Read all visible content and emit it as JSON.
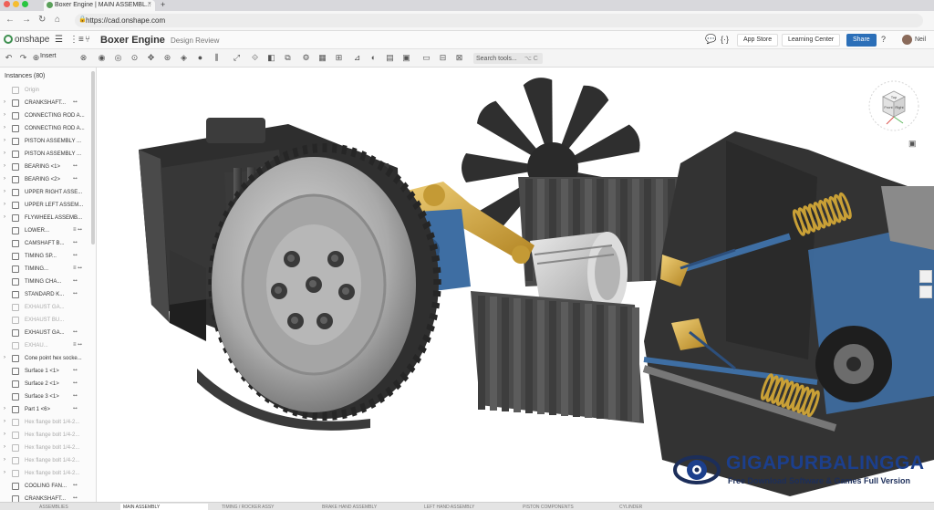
{
  "browser": {
    "tab_title": "Boxer Engine | MAIN ASSEMBL...",
    "new_tab": "+",
    "url": "https://cad.onshape.com"
  },
  "app": {
    "brand": "onshape",
    "doc_title": "Boxer Engine",
    "doc_subtitle": "Design Review",
    "buttons": {
      "app_store": "App Store",
      "learning_center": "Learning Center",
      "share": "Share",
      "help": "?",
      "user": "Neil"
    }
  },
  "toolbar": {
    "insert": "Insert",
    "search_placeholder": "Search tools...",
    "search_shortcut": "⌥ C"
  },
  "instances": {
    "header": "Instances (80)",
    "items": [
      {
        "label": "Origin",
        "chev": "",
        "extra": "",
        "dim": true
      },
      {
        "label": "CRANKSHAFT...",
        "chev": "›",
        "extra": "⭤",
        "dim": false
      },
      {
        "label": "CONNECTING ROD A...",
        "chev": "›",
        "extra": "",
        "dim": false
      },
      {
        "label": "CONNECTING ROD A...",
        "chev": "›",
        "extra": "",
        "dim": false
      },
      {
        "label": "PISTON ASSEMBLY ...",
        "chev": "›",
        "extra": "",
        "dim": false
      },
      {
        "label": "PISTON ASSEMBLY ...",
        "chev": "›",
        "extra": "",
        "dim": false
      },
      {
        "label": "BEARING <1>",
        "chev": "›",
        "extra": "⭤",
        "dim": false
      },
      {
        "label": "BEARING <2>",
        "chev": "›",
        "extra": "⭤",
        "dim": false
      },
      {
        "label": "UPPER RIGHT ASSE...",
        "chev": "›",
        "extra": "",
        "dim": false
      },
      {
        "label": "UPPER LEFT ASSEM...",
        "chev": "›",
        "extra": "",
        "dim": false
      },
      {
        "label": "FLYWHEEL ASSEMB...",
        "chev": "›",
        "extra": "",
        "dim": false
      },
      {
        "label": "LOWER...",
        "chev": "",
        "extra": "≡ ⭤",
        "dim": false
      },
      {
        "label": "CAMSHAFT B...",
        "chev": "",
        "extra": "⭤",
        "dim": false
      },
      {
        "label": "TIMING SP...",
        "chev": "",
        "extra": "⭤",
        "dim": false
      },
      {
        "label": "TIMING...",
        "chev": "",
        "extra": "≡ ⭤",
        "dim": false
      },
      {
        "label": "TIMING CHA...",
        "chev": "",
        "extra": "⭤",
        "dim": false
      },
      {
        "label": "STANDARD K...",
        "chev": "",
        "extra": "⭤",
        "dim": false
      },
      {
        "label": "EXHAUST GA...",
        "chev": "",
        "extra": "",
        "dim": true
      },
      {
        "label": "EXHAUST BU...",
        "chev": "",
        "extra": "",
        "dim": true
      },
      {
        "label": "EXHAUST GA...",
        "chev": "",
        "extra": "⭤",
        "dim": false
      },
      {
        "label": "EXHAU...",
        "chev": "",
        "extra": "≡ ⭤",
        "dim": true
      },
      {
        "label": "Cone point hex socke...",
        "chev": "›",
        "extra": "",
        "dim": false
      },
      {
        "label": "Surface 1 <1>",
        "chev": "",
        "extra": "⭤",
        "dim": false
      },
      {
        "label": "Surface 2 <1>",
        "chev": "",
        "extra": "⭤",
        "dim": false
      },
      {
        "label": "Surface 3 <1>",
        "chev": "",
        "extra": "⭤",
        "dim": false
      },
      {
        "label": "Part 1 <6>",
        "chev": "›",
        "extra": "⭤",
        "dim": false
      },
      {
        "label": "Hex flange bolt 1/4-2...",
        "chev": "›",
        "extra": "",
        "dim": true
      },
      {
        "label": "Hex flange bolt 1/4-2...",
        "chev": "›",
        "extra": "",
        "dim": true
      },
      {
        "label": "Hex flange bolt 1/4-2...",
        "chev": "›",
        "extra": "",
        "dim": true
      },
      {
        "label": "Hex flange bolt 1/4-2...",
        "chev": "›",
        "extra": "",
        "dim": true
      },
      {
        "label": "Hex flange bolt 1/4-2...",
        "chev": "›",
        "extra": "",
        "dim": true
      },
      {
        "label": "COOLING FAN...",
        "chev": "",
        "extra": "⭤",
        "dim": false
      },
      {
        "label": "CRANKSHAFT...",
        "chev": "",
        "extra": "⭤",
        "dim": false
      }
    ]
  },
  "bottom_tabs": [
    "ASSEMBLIES",
    "MAIN ASSEMBLY",
    "TIMING / ROCKER ASSY",
    "BRAKE HAND ASSEMBLY",
    "LEFT HAND ASSEMBLY",
    "PISTON COMPONENTS",
    "CYLINDER"
  ],
  "viewcube": {
    "top": "Top",
    "front": "Front",
    "right": "Right"
  },
  "watermark": {
    "title_a": "GIGA",
    "title_b": "PURBALINGGA",
    "subtitle": "Free Download Software & Games Full Version"
  },
  "colors": {
    "share_blue": "#2b6fb8",
    "onshape_green": "#3d8f4f",
    "brass": "#d4a83a",
    "steel_blue": "#3e6ea3",
    "dark_part": "#3a3a3a",
    "watermark_navy": "#1c2e5a"
  }
}
